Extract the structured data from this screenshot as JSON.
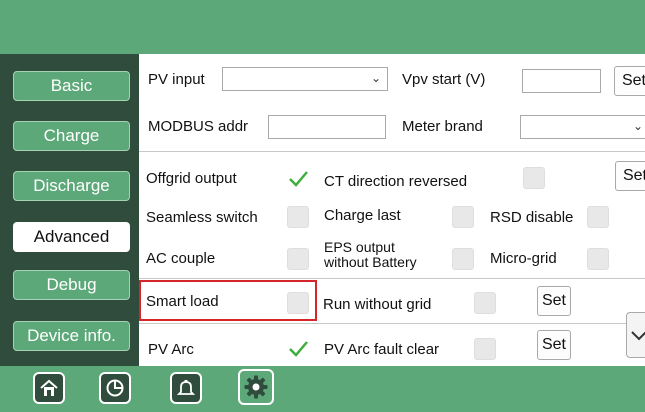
{
  "sidebar": {
    "items": [
      {
        "label": "Basic",
        "active": false
      },
      {
        "label": "Charge",
        "active": false
      },
      {
        "label": "Discharge",
        "active": false
      },
      {
        "label": "Advanced",
        "active": true
      },
      {
        "label": "Debug",
        "active": false
      },
      {
        "label": "Device info.",
        "active": false
      }
    ]
  },
  "main": {
    "pv_input_label": "PV input",
    "pv_input_value": "",
    "vpv_start_label": "Vpv start (V)",
    "vpv_start_value": "",
    "set_label": "Set",
    "modbus_addr_label": "MODBUS addr",
    "modbus_addr_value": "",
    "meter_brand_label": "Meter brand",
    "meter_brand_value": "",
    "offgrid_output_label": "Offgrid output",
    "offgrid_output_checked": true,
    "ct_direction_label": "CT direction reversed",
    "ct_direction_checked": false,
    "seamless_switch_label": "Seamless switch",
    "seamless_switch_checked": false,
    "charge_last_label": "Charge last",
    "charge_last_checked": false,
    "rsd_disable_label": "RSD disable",
    "rsd_disable_checked": false,
    "ac_couple_label": "AC couple",
    "ac_couple_checked": false,
    "eps_output_label_line1": "EPS output",
    "eps_output_label_line2": "without Battery",
    "eps_output_checked": false,
    "micro_grid_label": "Micro-grid",
    "micro_grid_checked": false,
    "smart_load_label": "Smart load",
    "smart_load_checked": false,
    "run_without_grid_label": "Run without grid",
    "run_without_grid_checked": false,
    "pv_arc_label": "PV Arc",
    "pv_arc_checked": true,
    "pv_arc_fault_clear_label": "PV Arc fault clear",
    "pv_arc_fault_clear_checked": false
  },
  "footer": {
    "icons": [
      "home-icon",
      "pie-chart-icon",
      "bell-icon",
      "gear-icon"
    ],
    "active": "gear-icon"
  },
  "colors": {
    "header_green": "#5ca879",
    "sidebar_dark": "#2f4c3c",
    "check_green": "#3fae3f",
    "highlight_red": "#d7262b"
  }
}
